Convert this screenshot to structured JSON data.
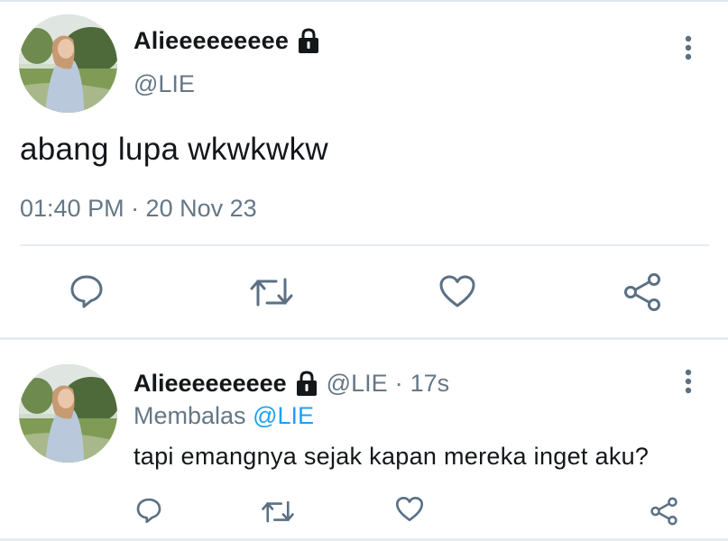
{
  "main_tweet": {
    "display_name": "Alieeeeeeeee",
    "handle": "@LIE",
    "text": "abang lupa wkwkwkw",
    "timestamp": "01:40 PM · 20 Nov 23",
    "icons": {
      "lock": "lock-icon",
      "more": "more-vertical-icon",
      "actions": [
        "reply-icon",
        "retweet-icon",
        "like-icon",
        "share-icon"
      ]
    }
  },
  "reply_tweet": {
    "display_name": "Alieeeeeeeee",
    "handle": "@LIE",
    "separator": "·",
    "age": "17s",
    "replying_prefix": "Membalas",
    "replying_to": "@LIE",
    "text": "tapi emangnya sejak kapan mereka inget aku?",
    "icons": {
      "lock": "lock-icon",
      "more": "more-vertical-icon",
      "actions": [
        "reply-icon",
        "retweet-icon",
        "like-icon",
        "share-icon"
      ]
    }
  },
  "colors": {
    "text_primary": "#14171a",
    "text_secondary": "#657786",
    "mention": "#1da1f2",
    "divider": "#e6ecf0",
    "icon": "#5b7083"
  }
}
